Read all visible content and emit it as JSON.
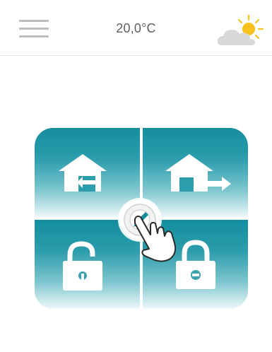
{
  "header": {
    "temperature": "20,0°C",
    "menu_icon": "hamburger-menu-icon",
    "weather_icon": "partly-sunny-icon"
  },
  "controls": {
    "top_left": {
      "icon": "arrive-home-icon"
    },
    "top_right": {
      "icon": "leave-home-icon"
    },
    "bottom_left": {
      "icon": "unlocked-padlock-icon"
    },
    "bottom_right": {
      "icon": "locked-padlock-icon"
    },
    "center": {
      "icon": "edit-pencil-icon"
    },
    "gesture": {
      "icon": "tap-hand-icon"
    }
  },
  "colors": {
    "accent": "#138d9e",
    "header_text": "#5f5f5f",
    "sun": "#f7c21b",
    "cloud": "#d8d8d8"
  }
}
